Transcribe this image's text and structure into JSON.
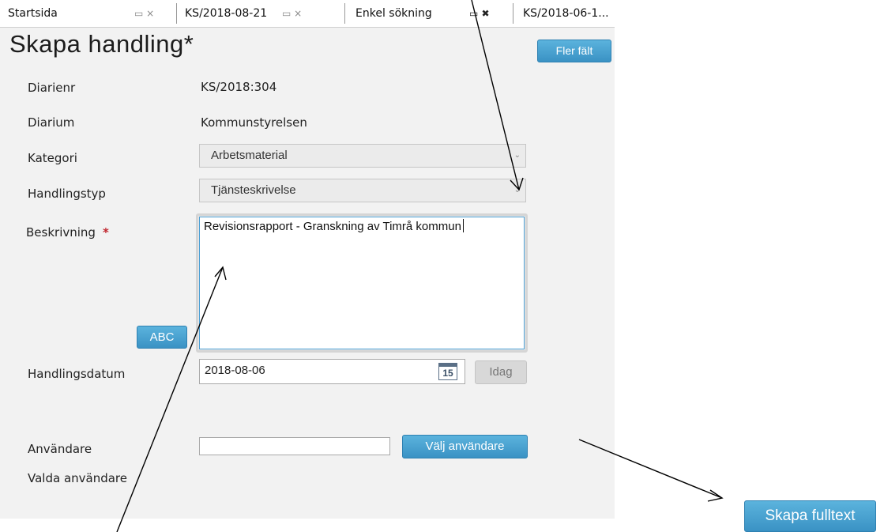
{
  "tabs": [
    {
      "label": "Startsida"
    },
    {
      "label": "KS/2018-08-21"
    },
    {
      "label": "Enkel sökning"
    },
    {
      "label": "KS/2018-06-1..."
    }
  ],
  "tab_icons": {
    "inactive": "▭ ×",
    "active": "▭ ✖"
  },
  "form": {
    "title": "Skapa handling*",
    "more_fields_button": "Fler fält",
    "diarienr_label": "Diarienr",
    "diarienr_value": "KS/2018:304",
    "diarium_label": "Diarium",
    "diarium_value": "Kommunstyrelsen",
    "kategori_label": "Kategori",
    "kategori_value": "Arbetsmaterial",
    "handlingstyp_label": "Handlingstyp",
    "handlingstyp_value": "Tjänsteskrivelse",
    "beskrivning_label": "Beskrivning",
    "required_marker": "*",
    "beskrivning_value": "Revisionsrapport - Granskning av Timrå kommun",
    "spellcheck_button": "ABC",
    "handlingsdatum_label": "Handlingsdatum",
    "handlingsdatum_value": "2018-08-06",
    "calendar_day": "15",
    "today_button": "Idag",
    "anvandare_label": "Användare",
    "anvandare_value": "",
    "select_user_button": "Välj användare",
    "valda_anvandare_label": "Valda användare"
  },
  "external_button": "Skapa fulltext",
  "icons": {
    "dropdown": "chevron-down-icon",
    "calendar": "calendar-icon",
    "tab_pin": "pin-icon",
    "tab_close": "close-icon"
  },
  "colors": {
    "accent": "#3a92c4",
    "required": "#c0252d",
    "panel_bg": "#f2f2f2"
  }
}
